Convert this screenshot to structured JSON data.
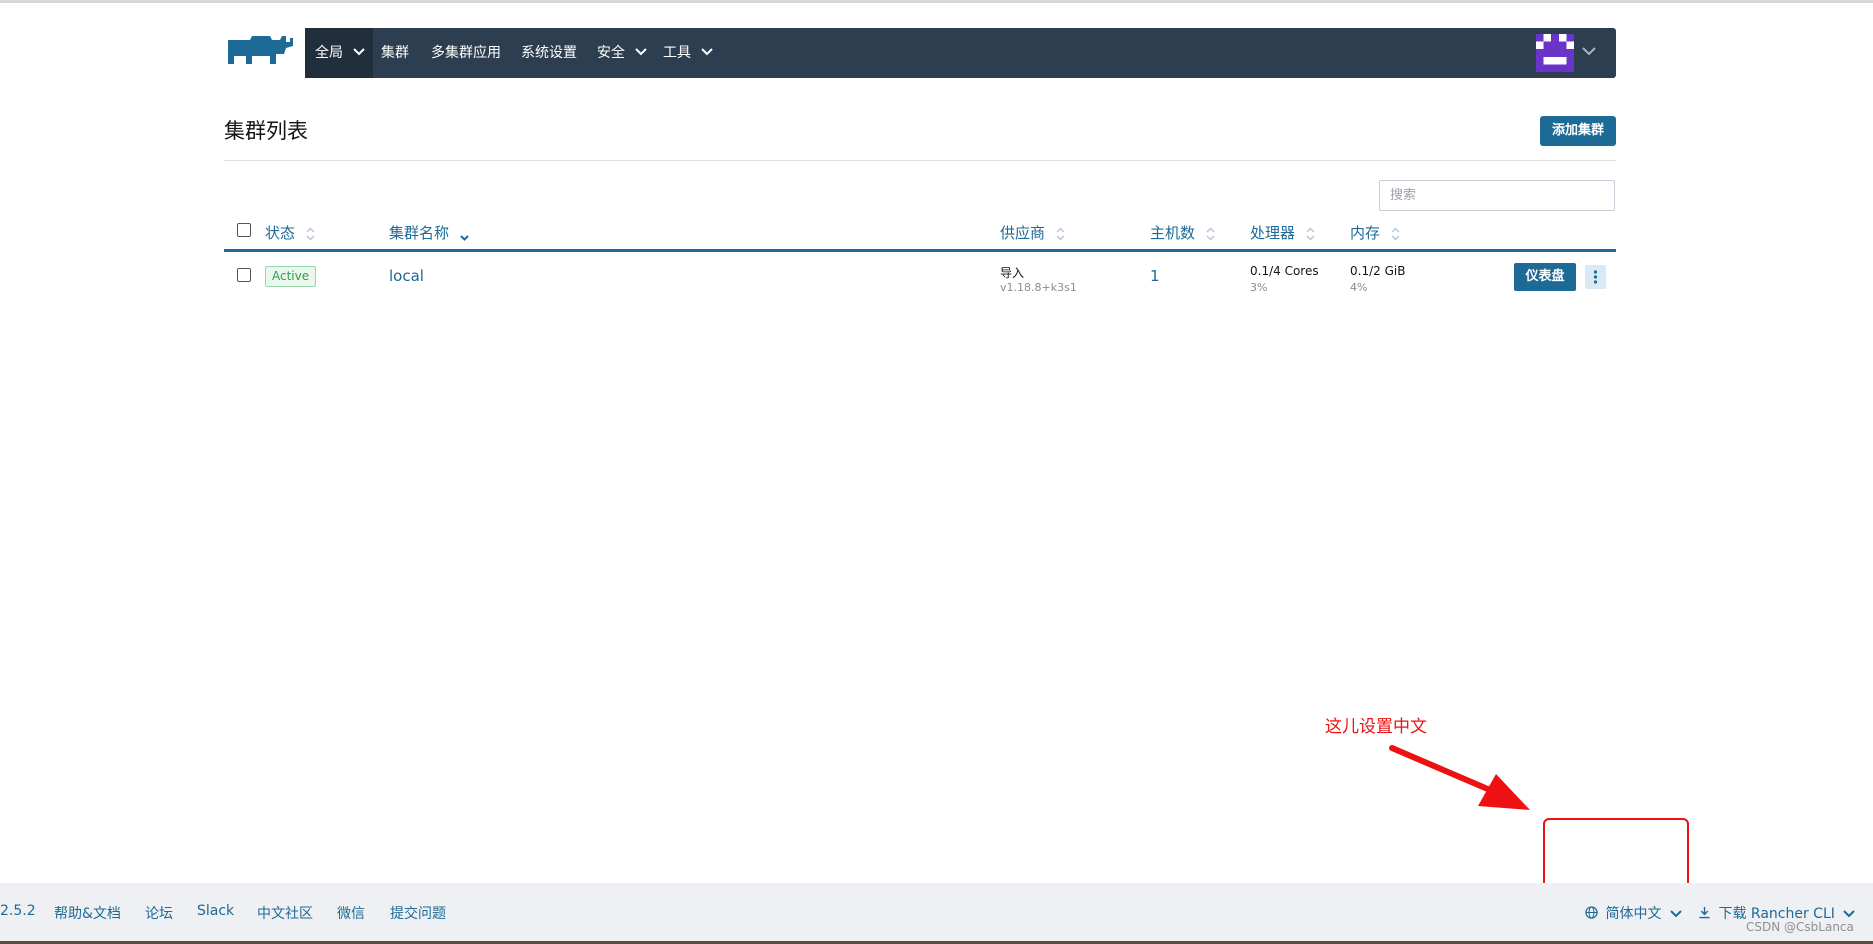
{
  "nav": {
    "items": [
      {
        "label": "全局",
        "has_dropdown": true,
        "active": true
      },
      {
        "label": "集群",
        "has_dropdown": false
      },
      {
        "label": "多集群应用",
        "has_dropdown": false
      },
      {
        "label": "系统设置",
        "has_dropdown": false
      },
      {
        "label": "安全",
        "has_dropdown": true
      },
      {
        "label": "工具",
        "has_dropdown": true
      }
    ],
    "brand_color": "#2c3e50",
    "avatar_icon": "user-avatar-icon"
  },
  "page": {
    "title": "集群列表",
    "add_button": "添加集群"
  },
  "search": {
    "placeholder": "搜索",
    "value": ""
  },
  "table": {
    "columns": [
      "状态",
      "集群名称",
      "供应商",
      "主机数",
      "处理器",
      "内存"
    ],
    "rows": [
      {
        "status": "Active",
        "name": "local",
        "provider": "导入",
        "provider_version": "v1.18.8+k3s1",
        "hosts": "1",
        "cpu": "0.1/4 Cores",
        "cpu_pct": "3%",
        "memory": "0.1/2 GiB",
        "memory_pct": "4%",
        "action": "仪表盘"
      }
    ]
  },
  "annotation": {
    "text": "这儿设置中文",
    "color": "#ee1111"
  },
  "footer": {
    "version": "2.5.2",
    "links": [
      "帮助&文档",
      "论坛",
      "Slack",
      "中文社区",
      "微信",
      "提交问题"
    ],
    "language": "简体中文",
    "download": "下载 Rancher CLI"
  },
  "watermark": "CSDN @CsbLanca",
  "colors": {
    "accent": "#1d6a96",
    "active_badge": "#2f9f4a"
  }
}
